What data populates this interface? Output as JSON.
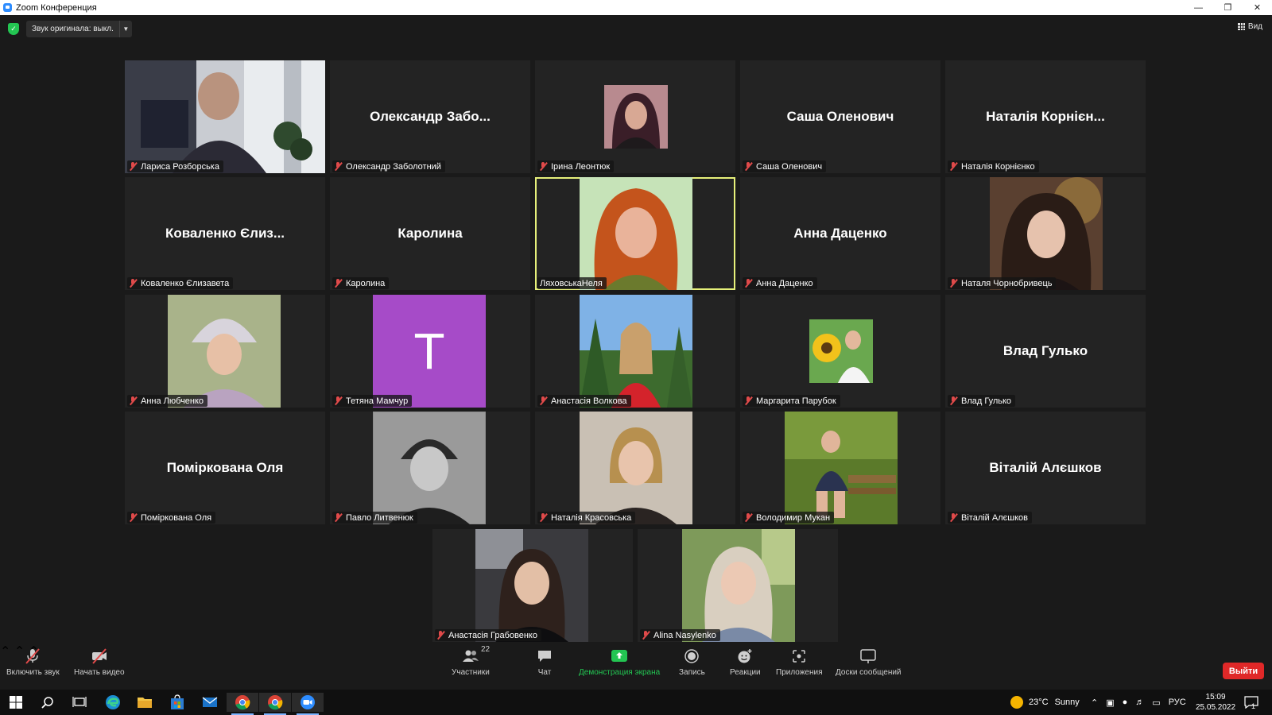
{
  "window": {
    "title": "Zoom Конференция"
  },
  "topbar": {
    "original_audio": "Звук оригинала: выкл.",
    "view_label": "Вид"
  },
  "tiles": [
    {
      "label": "Лариса Розборська"
    },
    {
      "label": "Олександр Заболотний",
      "big": "Олександр  Забо..."
    },
    {
      "label": "Ірина Леонтюк"
    },
    {
      "label": "Саша Оленович",
      "big": "Саша Оленович"
    },
    {
      "label": "Наталія Корнієнко",
      "big": "Наталія Корнієн..."
    },
    {
      "label": "Коваленко Єлизавета",
      "big": "Коваленко Єлиз..."
    },
    {
      "label": "Каролина",
      "big": "Каролина"
    },
    {
      "label": "ЛяховськаНеля"
    },
    {
      "label": "Анна Даценко",
      "big": "Анна Даценко"
    },
    {
      "label": "Наталя Чорнобривець"
    },
    {
      "label": "Анна Любченко"
    },
    {
      "label": "Тетяна Мамчур",
      "letter": "T"
    },
    {
      "label": "Анастасія Волкова"
    },
    {
      "label": "Маргарита Парубок"
    },
    {
      "label": "Влад Гулько",
      "big": "Влад Гулько"
    },
    {
      "label": "Поміркована Оля",
      "big": "Поміркована Оля"
    },
    {
      "label": "Павло Литвенюк"
    },
    {
      "label": "Наталія Красовська"
    },
    {
      "label": "Володимир Мукан"
    },
    {
      "label": "Віталій Алєшков",
      "big": "Віталій Алєшков"
    },
    {
      "label": "Анастасія Грабовенко"
    },
    {
      "label": "Alina Nasylenko"
    }
  ],
  "toolbar": {
    "unmute": "Включить звук",
    "start_video": "Начать видео",
    "participants": "Участники",
    "participants_count": "22",
    "chat": "Чат",
    "share_screen": "Демонстрация экрана",
    "record": "Запись",
    "reactions": "Реакции",
    "apps": "Приложения",
    "whiteboards": "Доски сообщений",
    "leave": "Выйти"
  },
  "taskbar": {
    "weather_temp": "23°C",
    "weather_cond": "Sunny",
    "lang": "РУС",
    "time": "15:09",
    "date": "25.05.2022",
    "notifications": "1"
  },
  "colors": {
    "share_green": "#23c552",
    "leave_red": "#e02828",
    "active_speaker": "#e6f07a",
    "avatar_purple": "#a64bc8"
  }
}
